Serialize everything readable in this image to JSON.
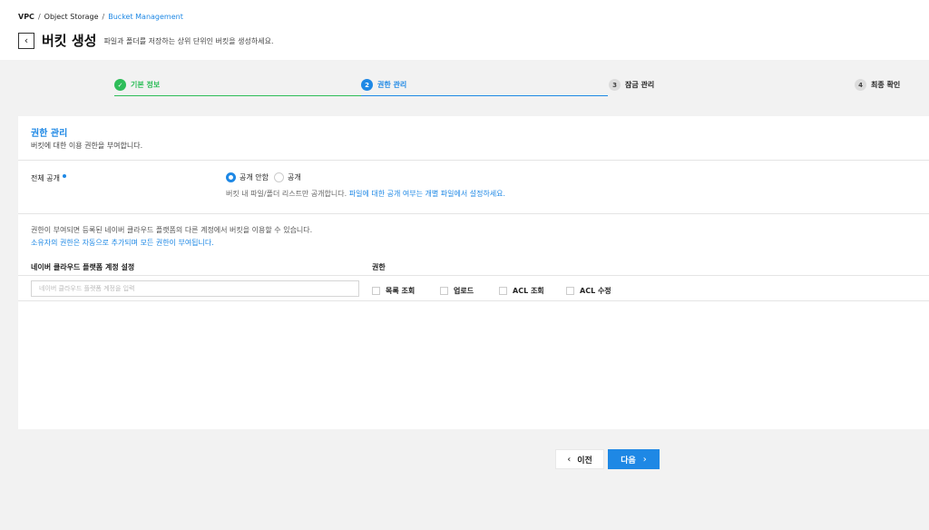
{
  "breadcrumb": {
    "items": [
      "VPC",
      "Object Storage"
    ],
    "separator": "/",
    "current": "Bucket Management"
  },
  "header": {
    "title": "버킷 생성",
    "description": "파일과 폴더를 저장하는 상위 단위인 버킷을 생성하세요."
  },
  "stepper": {
    "steps": [
      {
        "num": "1",
        "label": "기본 정보",
        "state": "done"
      },
      {
        "num": "2",
        "label": "권한 관리",
        "state": "active"
      },
      {
        "num": "3",
        "label": "잠금 관리",
        "state": "todo"
      },
      {
        "num": "4",
        "label": "최종 확인",
        "state": "todo"
      }
    ]
  },
  "section": {
    "title": "권한 관리",
    "description": "버킷에 대한 이용 권한을 부여합니다."
  },
  "public_access": {
    "label": "전체 공개",
    "options": [
      {
        "label": "공개 안함",
        "checked": true
      },
      {
        "label": "공개",
        "checked": false
      }
    ],
    "help_gray": "버킷 내 파일/폴더 리스트만 공개합니다.",
    "help_blue": "파일에 대한 공개 여부는 개별 파일에서 설정하세요."
  },
  "info": {
    "line1": "권한이 부여되면 등록된 네이버 클라우드 플랫폼의 다른 계정에서 버킷을 이용할 수 있습니다.",
    "line2": "소유자의 권한은 자동으로 추가되며 모든 권한이 부여됩니다."
  },
  "account": {
    "column_label": "네이버 클라우드 플랫폼 계정 설정",
    "input_placeholder": "네이버 클라우드 플랫폼 계정을 입력",
    "input_value": ""
  },
  "permissions": {
    "column_label": "권한",
    "options": [
      {
        "label": "목록 조회",
        "checked": false
      },
      {
        "label": "업로드",
        "checked": false
      },
      {
        "label": "ACL 조회",
        "checked": false
      },
      {
        "label": "ACL 수정",
        "checked": false
      }
    ]
  },
  "footer": {
    "prev_label": "이전",
    "next_label": "다음"
  },
  "colors": {
    "accent": "#1e88e5",
    "success": "#2ebd59"
  }
}
